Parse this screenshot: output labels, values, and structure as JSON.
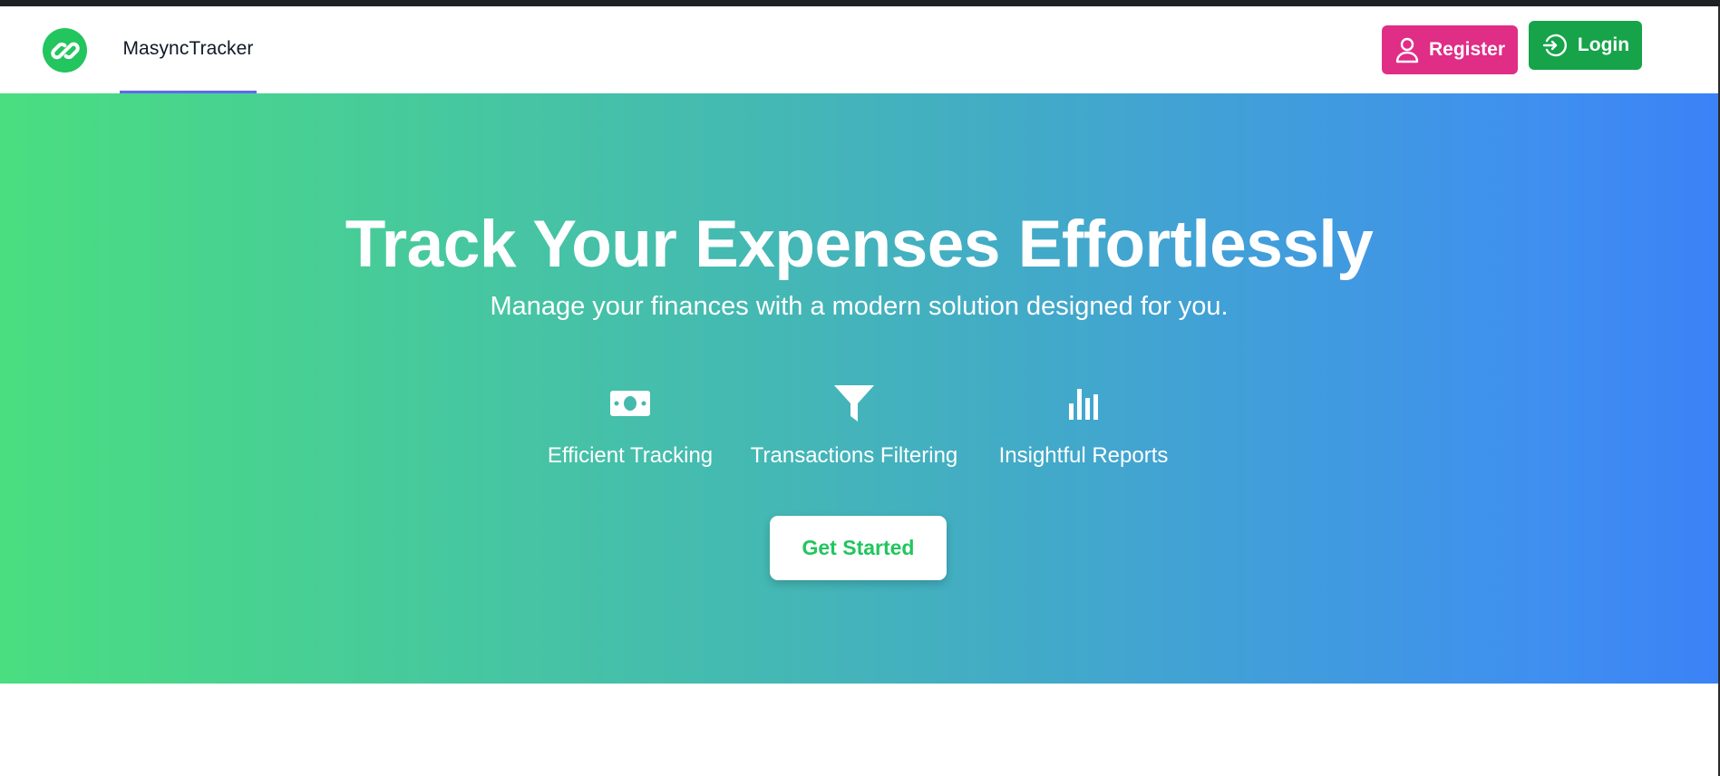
{
  "navbar": {
    "brand": "MasyncTracker",
    "logo_icon": "link-circle-icon",
    "register_label": "Register",
    "register_icon": "user-icon",
    "login_label": "Login",
    "login_icon": "login-arrow-icon"
  },
  "hero": {
    "title": "Track Your Expenses Effortlessly",
    "subtitle": "Manage your finances with a modern solution designed for you.",
    "features": [
      {
        "label": "Efficient Tracking",
        "icon": "money-bill-icon"
      },
      {
        "label": "Transactions Filtering",
        "icon": "filter-funnel-icon"
      },
      {
        "label": "Insightful Reports",
        "icon": "bar-chart-icon"
      }
    ],
    "cta_label": "Get Started"
  },
  "colors": {
    "brand_green": "#22c55e",
    "register_pink": "#e02d86",
    "login_green": "#16a34a",
    "nav_underline": "#6366f1",
    "gradient_start": "#4ade80",
    "gradient_end": "#3b82f6"
  }
}
